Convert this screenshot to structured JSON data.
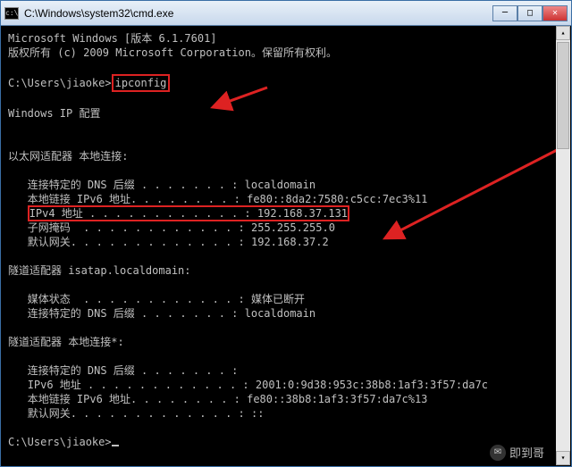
{
  "window": {
    "title": "C:\\Windows\\system32\\cmd.exe"
  },
  "header": {
    "line1": "Microsoft Windows [版本 6.1.7601]",
    "line2": "版权所有 (c) 2009 Microsoft Corporation。保留所有权利。"
  },
  "prompt1": {
    "path": "C:\\Users\\jiaoke>",
    "command": "ipconfig"
  },
  "ipconfig": {
    "title": "Windows IP 配置",
    "adapter1": {
      "header": "以太网适配器 本地连接:",
      "rows": [
        {
          "label": "连接特定的 DNS 后缀",
          "dots": " . . . . . . . :",
          "value": " localdomain"
        },
        {
          "label": "本地链接 IPv6 地址",
          "dots": ". . . . . . . . :",
          "value": " fe80::8da2:7580:c5cc:7ec3%11"
        },
        {
          "label": "IPv4 地址",
          "dots": " . . . . . . . . . . . . :",
          "value": " 192.168.37.131"
        },
        {
          "label": "子网掩码",
          "dots": "  . . . . . . . . . . . . :",
          "value": " 255.255.255.0"
        },
        {
          "label": "默认网关",
          "dots": ". . . . . . . . . . . . . :",
          "value": " 192.168.37.2"
        }
      ]
    },
    "adapter2": {
      "header": "隧道适配器 isatap.localdomain:",
      "rows": [
        {
          "label": "媒体状态",
          "dots": "  . . . . . . . . . . . . :",
          "value": " 媒体已断开"
        },
        {
          "label": "连接特定的 DNS 后缀",
          "dots": " . . . . . . . :",
          "value": " localdomain"
        }
      ]
    },
    "adapter3": {
      "header": "隧道适配器 本地连接*:",
      "rows": [
        {
          "label": "连接特定的 DNS 后缀",
          "dots": " . . . . . . . :",
          "value": ""
        },
        {
          "label": "IPv6 地址",
          "dots": " . . . . . . . . . . . . :",
          "value": " 2001:0:9d38:953c:38b8:1af3:3f57:da7c"
        },
        {
          "label": "本地链接 IPv6 地址",
          "dots": ". . . . . . . . :",
          "value": " fe80::38b8:1af3:3f57:da7c%13"
        },
        {
          "label": "默认网关",
          "dots": ". . . . . . . . . . . . . :",
          "value": " ::"
        }
      ]
    }
  },
  "prompt2": {
    "path": "C:\\Users\\jiaoke>"
  },
  "watermark": {
    "text": "即到哥"
  }
}
